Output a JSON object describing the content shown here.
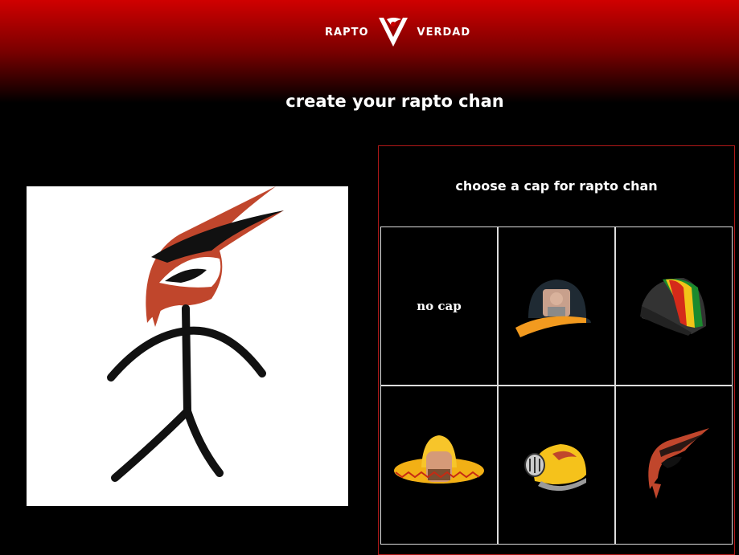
{
  "brand": {
    "left_word": "RAPTO",
    "right_word": "VERDAD",
    "accent": "#cc0000"
  },
  "page": {
    "title": "create your rapto chan"
  },
  "preview": {
    "name": "rapto chan preview",
    "background": "#ffffff"
  },
  "cap_picker": {
    "heading": "choose a cap for rapto chan",
    "options": [
      {
        "label": "no cap",
        "icon": "no-cap"
      },
      {
        "label": "",
        "icon": "baseball-cap-with-face"
      },
      {
        "label": "",
        "icon": "rasta-beanie"
      },
      {
        "label": "",
        "icon": "sombrero-with-face"
      },
      {
        "label": "",
        "icon": "yellow-helmet"
      },
      {
        "label": "",
        "icon": "rapto-logo-cap"
      }
    ]
  }
}
